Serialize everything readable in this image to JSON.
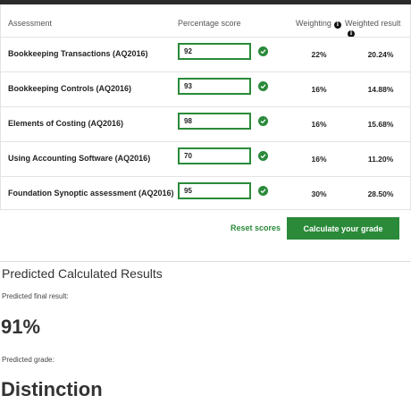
{
  "table": {
    "headers": {
      "assessment": "Assessment",
      "percentage": "Percentage score",
      "weighting": "Weighting",
      "weighted_result": "Weighted result"
    },
    "rows": [
      {
        "name": "Bookkeeping Transactions (AQ2016)",
        "score": "92",
        "weighting": "22%",
        "result": "20.24%"
      },
      {
        "name": "Bookkeeping Controls (AQ2016)",
        "score": "93",
        "weighting": "16%",
        "result": "14.88%"
      },
      {
        "name": "Elements of Costing (AQ2016)",
        "score": "98",
        "weighting": "16%",
        "result": "15.68%"
      },
      {
        "name": "Using Accounting Software (AQ2016)",
        "score": "70",
        "weighting": "16%",
        "result": "11.20%"
      },
      {
        "name": "Foundation Synoptic assessment (AQ2016)",
        "score": "95",
        "weighting": "30%",
        "result": "28.50%"
      }
    ]
  },
  "actions": {
    "reset": "Reset scores",
    "calculate": "Calculate your grade"
  },
  "results": {
    "title": "Predicted Calculated Results",
    "final_label": "Predicted final result:",
    "final_value": "91%",
    "grade_label": "Predicted grade:",
    "grade_value": "Distinction"
  },
  "icons": {
    "valid": "check-circle-icon",
    "info": "info-icon"
  },
  "colors": {
    "accent": "#2a8a3a",
    "topbar": "#2b2b2b"
  }
}
